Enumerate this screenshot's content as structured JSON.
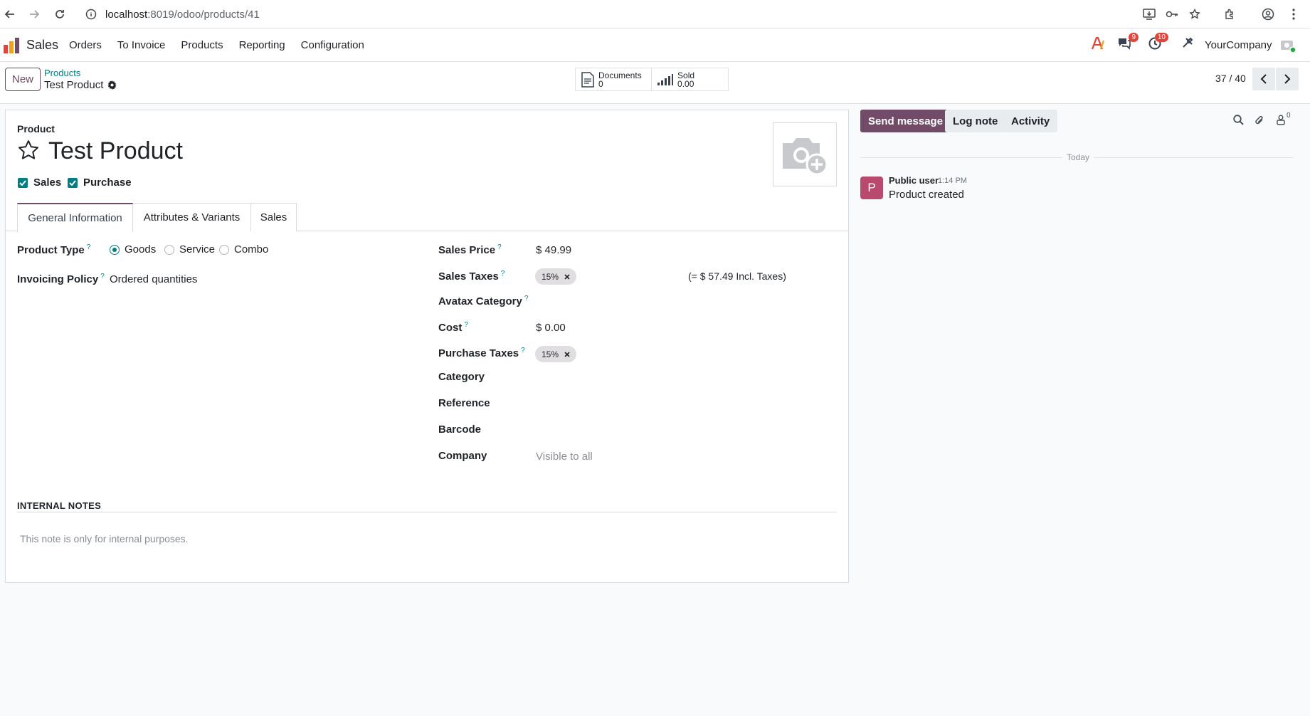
{
  "browser": {
    "url_host": "localhost",
    "url_path": ":8019/odoo/products/41"
  },
  "navbar": {
    "app_name": "Sales",
    "menu": [
      "Orders",
      "To Invoice",
      "Products",
      "Reporting",
      "Configuration"
    ],
    "messages_count": "9",
    "activities_count": "10",
    "company": "YourCompany"
  },
  "control_panel": {
    "new_label": "New",
    "breadcrumb_parent": "Products",
    "breadcrumb_current": "Test Product",
    "smart_buttons": [
      {
        "label": "Documents",
        "value": "0"
      },
      {
        "label": "Sold",
        "value": "0.00"
      }
    ],
    "pager": "37 / 40"
  },
  "form": {
    "product_label": "Product",
    "name": "Test Product",
    "checkboxes": [
      {
        "label": "Sales",
        "checked": true
      },
      {
        "label": "Purchase",
        "checked": true
      }
    ],
    "tabs": [
      "General Information",
      "Attributes & Variants",
      "Sales"
    ],
    "active_tab": "General Information",
    "product_type_label": "Product Type",
    "product_type_options": [
      "Goods",
      "Service",
      "Combo"
    ],
    "product_type_selected": "Goods",
    "invoicing_policy_label": "Invoicing Policy",
    "invoicing_policy_value": "Ordered quantities",
    "sales_price_label": "Sales Price",
    "sales_price_value": "$ 49.99",
    "sales_taxes_label": "Sales Taxes",
    "sales_taxes_tag": "15%",
    "incl_taxes": "(= $ 57.49 Incl. Taxes)",
    "avatax_label": "Avatax Category",
    "cost_label": "Cost",
    "cost_value": "$ 0.00",
    "purchase_taxes_label": "Purchase Taxes",
    "purchase_taxes_tag": "15%",
    "category_label": "Category",
    "reference_label": "Reference",
    "barcode_label": "Barcode",
    "company_label": "Company",
    "company_placeholder": "Visible to all",
    "help_mark": "?",
    "internal_notes_heading": "INTERNAL NOTES",
    "internal_notes_placeholder": "This note is only for internal purposes."
  },
  "chatter": {
    "send_message": "Send message",
    "log_note": "Log note",
    "activity": "Activity",
    "followers_count": "0",
    "date_separator": "Today",
    "messages": [
      {
        "avatar": "P",
        "author": "Public user",
        "time": "1:14 PM",
        "body": "Product created"
      }
    ]
  },
  "colors": {
    "brand": "#714b67",
    "accent": "#017e84",
    "badge": "#e0443b"
  }
}
